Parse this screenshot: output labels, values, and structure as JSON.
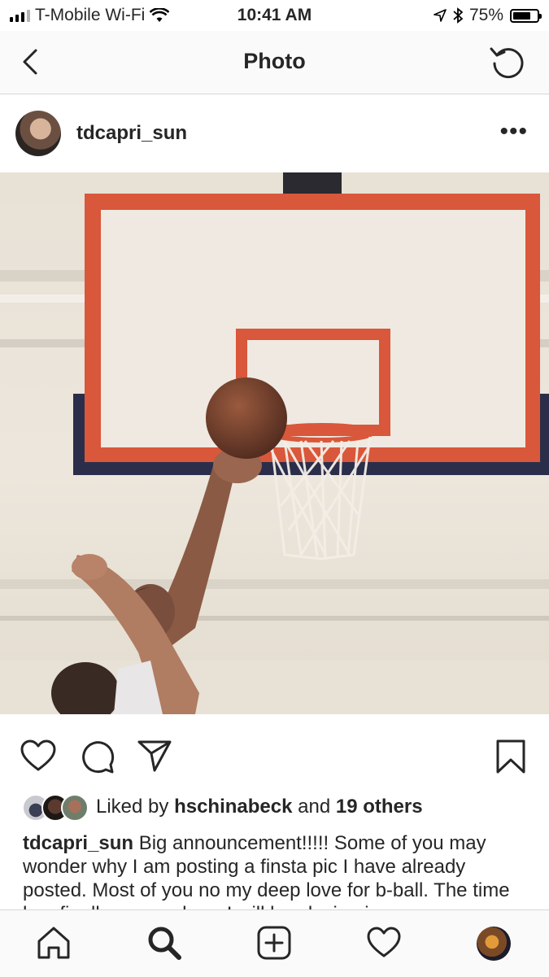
{
  "status_bar": {
    "carrier": "T-Mobile Wi-Fi",
    "time": "10:41 AM",
    "battery": "75%",
    "battery_level": 0.75
  },
  "nav": {
    "title": "Photo",
    "back_icon": "chevron-left-icon",
    "refresh_icon": "refresh-icon"
  },
  "post": {
    "username": "tdcapri_sun",
    "more_label": "•••",
    "likes": {
      "prefix": "Liked by ",
      "first_user": "hschinabeck",
      "middle": " and ",
      "others": "19 others"
    },
    "caption": {
      "author": "tdcapri_sun",
      "text": " Big announcement!!!!! Some of you may wonder why I am posting a finsta pic I have already posted. Most of you no my deep love for b-ball. The time has finally come where I will be playing in my"
    }
  },
  "actions": {
    "like": "heart-icon",
    "comment": "comment-icon",
    "share": "paper-plane-icon",
    "save": "bookmark-icon"
  },
  "tabbar": {
    "home": "home-icon",
    "search": "search-icon",
    "add": "add-post-icon",
    "activity": "heart-icon",
    "profile": "profile-avatar"
  },
  "colors": {
    "text": "#262626",
    "bar_background": "#fafafa",
    "divider": "#d6d6d6",
    "backboard_orange": "#d9573a",
    "backboard_navy": "#2b2e4a"
  }
}
